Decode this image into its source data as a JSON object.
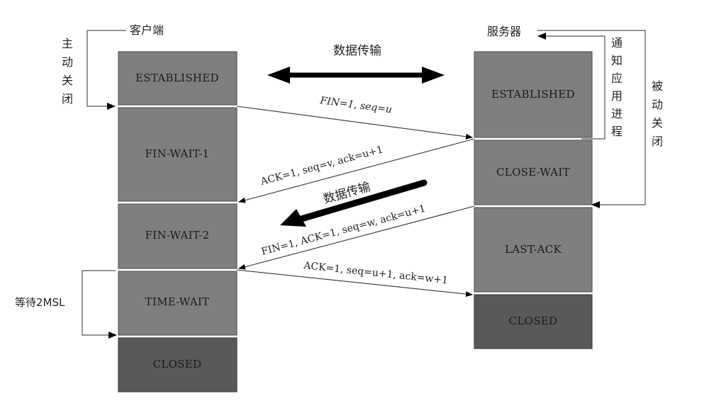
{
  "client": {
    "title": "客户端",
    "active_close_label": [
      "主",
      "动",
      "关",
      "闭"
    ],
    "wait_label": "等待2MSL",
    "states": [
      "ESTABLISHED",
      "FIN-WAIT-1",
      "FIN-WAIT-2",
      "TIME-WAIT",
      "CLOSED"
    ]
  },
  "server": {
    "title": "服务器",
    "notify_app_label": [
      "通",
      "知",
      "应",
      "用",
      "进",
      "程"
    ],
    "passive_close_label": [
      "被",
      "动",
      "关",
      "闭"
    ],
    "states": [
      "ESTABLISHED",
      "CLOSE-WAIT",
      "LAST-ACK",
      "CLOSED"
    ]
  },
  "data_transfer": {
    "bidirectional_label": "数据传输",
    "server_to_client_label": "数据传输"
  },
  "messages": [
    {
      "label": "FIN=1,  seq=u",
      "direction": "client-to-server"
    },
    {
      "label": "ACK=1, seq=v, ack=u+1",
      "direction": "server-to-client"
    },
    {
      "label": "FIN=1,  ACK=1,  seq=w, ack=u+1",
      "direction": "server-to-client"
    },
    {
      "label": "ACK=1, seq=u+1, ack=w+1",
      "direction": "client-to-server"
    }
  ]
}
